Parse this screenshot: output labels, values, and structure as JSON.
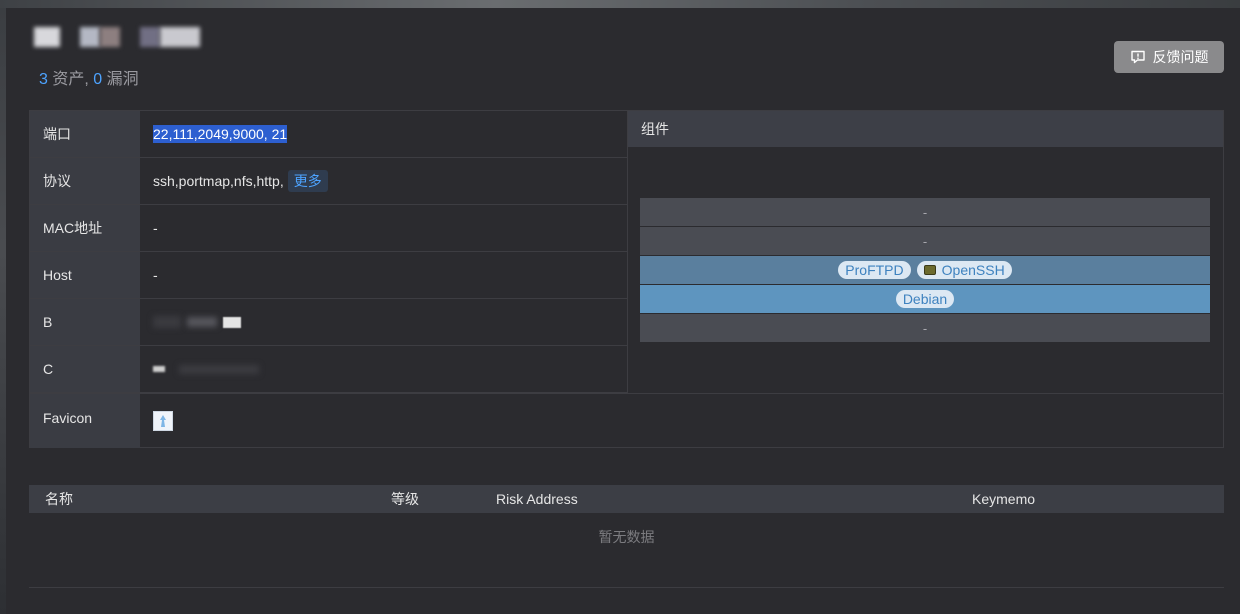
{
  "header": {
    "asset_count": "3",
    "asset_label": " 资产, ",
    "vuln_count": "0",
    "vuln_label": " 漏洞",
    "feedback_label": "反馈问题"
  },
  "info": {
    "port_label": "端口",
    "port_value": "22,111,2049,9000, 21",
    "protocol_label": "协议",
    "protocol_value": "ssh,portmap,nfs,http,",
    "more_label": "更多",
    "mac_label": "MAC地址",
    "mac_value": "-",
    "host_label": "Host",
    "host_value": "-",
    "b_label": "B",
    "c_label": "C",
    "favicon_label": "Favicon"
  },
  "components": {
    "header": "组件",
    "layers": [
      {
        "text": "-"
      },
      {
        "text": "-"
      },
      {
        "chips": [
          "ProFTPD",
          "OpenSSH"
        ]
      },
      {
        "chips": [
          "Debian"
        ]
      },
      {
        "text": "-"
      }
    ]
  },
  "vuln_table": {
    "columns": [
      "名称",
      "等级",
      "Risk Address",
      "Keymemo"
    ],
    "empty_text": "暂无数据"
  },
  "colors": {
    "accent": "#4da3ff",
    "selection": "#2d5fd0",
    "label_bg": "#3a3c43",
    "panel_bg": "#2b2b2f"
  }
}
